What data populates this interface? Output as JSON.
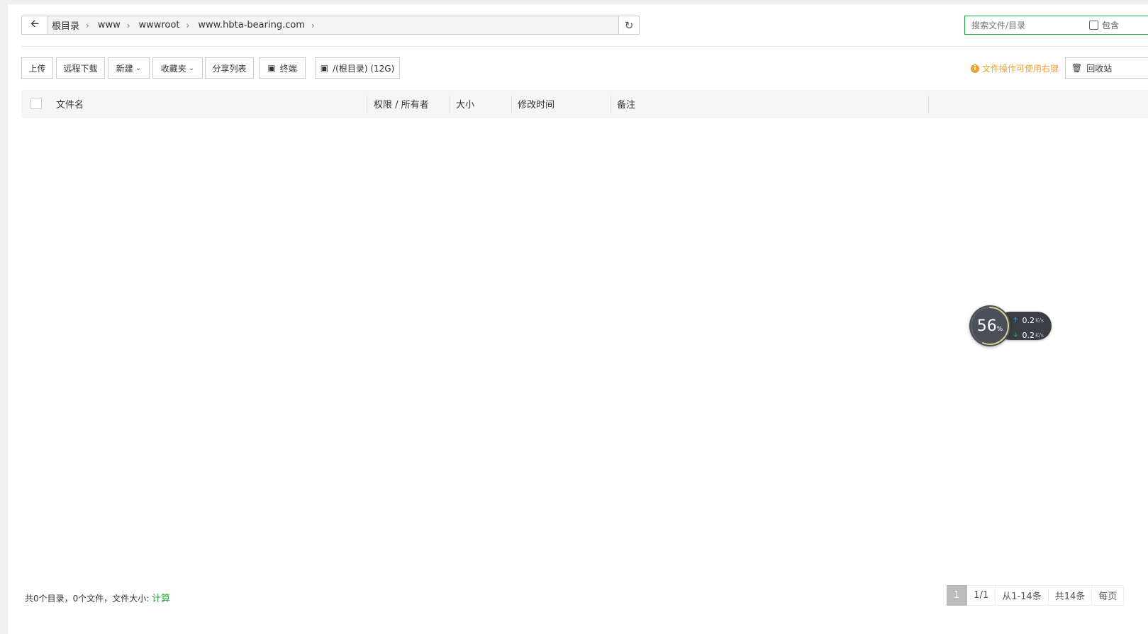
{
  "address_bar": {
    "crumbs": [
      "根目录",
      "www",
      "wwwroot",
      "www.hbta-bearing.com"
    ]
  },
  "search": {
    "placeholder": "搜索文件/目录",
    "include_label": "包含"
  },
  "toolbar": {
    "upload": "上传",
    "remote_download": "远程下载",
    "new": "新建",
    "favorites": "收藏夹",
    "share_list": "分享列表",
    "terminal": "终端",
    "disk": "/(根目录) (12G)",
    "tip": "文件操作可使用右键",
    "recycle": "回收站"
  },
  "table": {
    "columns": [
      "文件名",
      "权限 / 所有者",
      "大小",
      "修改时间",
      "备注"
    ]
  },
  "footer": {
    "summary": "共0个目录，0个文件，文件大小:",
    "calc": "计算"
  },
  "pager": {
    "current": "1",
    "pages": "1/1",
    "range": "从1-14条",
    "total": "共14条",
    "per_page": "每页"
  },
  "speed_widget": {
    "percent": "56",
    "percent_unit": "%",
    "up": "0.2",
    "down": "0.2",
    "unit": "K/s"
  }
}
